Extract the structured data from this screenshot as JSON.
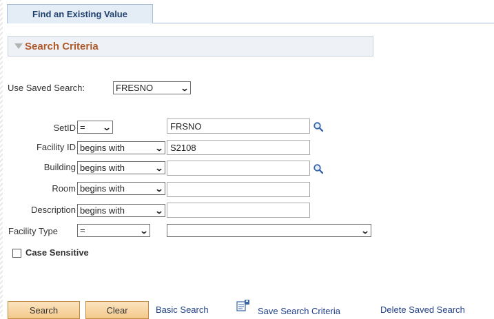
{
  "tab": {
    "label": "Find an Existing Value"
  },
  "section": {
    "title": "Search Criteria"
  },
  "saved_search": {
    "label": "Use Saved Search:",
    "value": "FRESNO"
  },
  "fields": {
    "setid": {
      "label": "SetID",
      "operator": "=",
      "value": "FRSNO"
    },
    "facility_id": {
      "label": "Facility ID",
      "operator": "begins with",
      "value": "S2108"
    },
    "building": {
      "label": "Building",
      "operator": "begins with",
      "value": ""
    },
    "room": {
      "label": "Room",
      "operator": "begins with",
      "value": ""
    },
    "description": {
      "label": "Description",
      "operator": "begins with",
      "value": ""
    },
    "facility_type": {
      "label": "Facility Type",
      "operator": "=",
      "value": ""
    }
  },
  "case_sensitive": {
    "label": "Case Sensitive",
    "checked": false
  },
  "actions": {
    "search": "Search",
    "clear": "Clear",
    "basic_search": "Basic Search",
    "save_search_criteria": "Save Search Criteria",
    "delete_saved_search": "Delete Saved Search"
  },
  "colors": {
    "button_bg": "#f3c98c",
    "section_title": "#b05a2a",
    "link": "#1f3f8a"
  }
}
